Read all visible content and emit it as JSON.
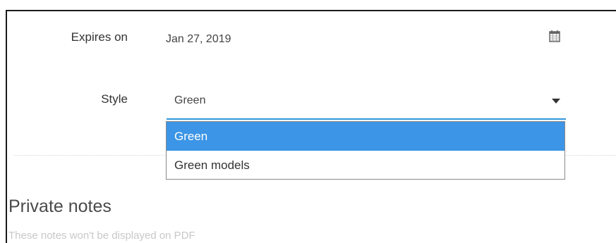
{
  "form": {
    "expires_label": "Expires on",
    "expires_value": "Jan 27, 2019",
    "style_label": "Style",
    "style_value": "Green"
  },
  "dropdown": {
    "options": [
      {
        "label": "Green",
        "selected": true
      },
      {
        "label": "Green models",
        "selected": false
      }
    ]
  },
  "private_notes": {
    "title": "Private notes",
    "hint": "These notes won't be displayed on PDF"
  },
  "icons": {
    "calendar": "calendar-icon",
    "caret": "chevron-down-icon"
  },
  "colors": {
    "accent": "#3498db",
    "selected_bg": "#3c95e6"
  }
}
